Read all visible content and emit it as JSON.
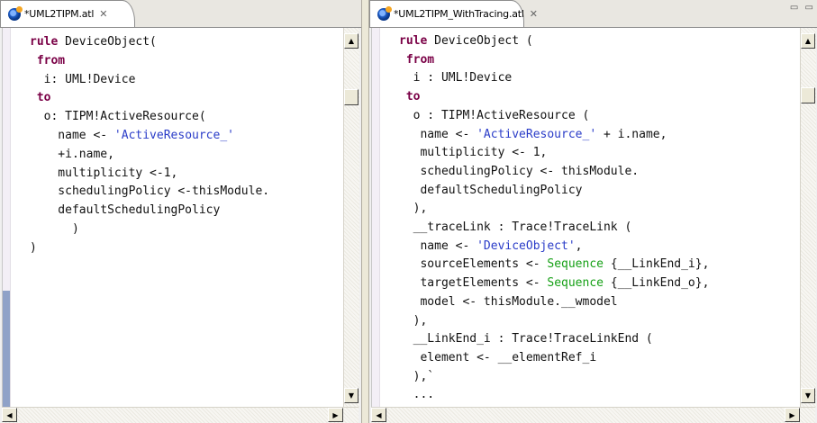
{
  "left_editor": {
    "tab_title": "*UML2TIPM.atl",
    "close_glyph": "✕",
    "lines": [
      [
        {
          "t": "rule",
          "c": "kw"
        },
        {
          "t": " DeviceObject("
        }
      ],
      [
        {
          "t": " "
        },
        {
          "t": "from",
          "c": "kw"
        }
      ],
      [
        {
          "t": "  i: UML!Device"
        }
      ],
      [
        {
          "t": " "
        },
        {
          "t": "to",
          "c": "kw"
        }
      ],
      [
        {
          "t": "  o: TIPM!ActiveResource("
        }
      ],
      [
        {
          "t": "    name <- "
        },
        {
          "t": "'ActiveResource_'",
          "c": "str"
        }
      ],
      [
        {
          "t": "    +i.name,"
        }
      ],
      [
        {
          "t": "    multiplicity <-1,"
        }
      ],
      [
        {
          "t": "    schedulingPolicy <-thisModule."
        }
      ],
      [
        {
          "t": "    defaultSchedulingPolicy"
        }
      ],
      [
        {
          "t": "      )"
        }
      ],
      [
        {
          "t": ")"
        }
      ]
    ]
  },
  "right_editor": {
    "tab_title": "*UML2TIPM_WithTracing.atl",
    "close_glyph": "✕",
    "view_controls": "▭ ▭",
    "lines": [
      [
        {
          "t": "rule",
          "c": "kw"
        },
        {
          "t": " DeviceObject ("
        }
      ],
      [
        {
          "t": " "
        },
        {
          "t": "from",
          "c": "kw"
        }
      ],
      [
        {
          "t": "  i : UML!Device"
        }
      ],
      [
        {
          "t": " "
        },
        {
          "t": "to",
          "c": "kw"
        }
      ],
      [
        {
          "t": "  o : TIPM!ActiveResource ("
        }
      ],
      [
        {
          "t": "   name <- "
        },
        {
          "t": "'ActiveResource_'",
          "c": "str"
        },
        {
          "t": " + i.name,"
        }
      ],
      [
        {
          "t": "   multiplicity <- 1,"
        }
      ],
      [
        {
          "t": "   schedulingPolicy <- thisModule."
        }
      ],
      [
        {
          "t": "   defaultSchedulingPolicy"
        }
      ],
      [
        {
          "t": "  ),"
        }
      ],
      [
        {
          "t": "  __traceLink : Trace!TraceLink ("
        }
      ],
      [
        {
          "t": "   name <- "
        },
        {
          "t": "'DeviceObject'",
          "c": "str"
        },
        {
          "t": ","
        }
      ],
      [
        {
          "t": "   sourceElements <- "
        },
        {
          "t": "Sequence",
          "c": "op"
        },
        {
          "t": " {__LinkEnd_i},"
        }
      ],
      [
        {
          "t": "   targetElements <- "
        },
        {
          "t": "Sequence",
          "c": "op"
        },
        {
          "t": " {__LinkEnd_o},"
        }
      ],
      [
        {
          "t": "   model <- thisModule.__wmodel"
        }
      ],
      [
        {
          "t": "  ),"
        }
      ],
      [
        {
          "t": "  __LinkEnd_i : Trace!TraceLinkEnd ("
        }
      ],
      [
        {
          "t": "   element <- __elementRef_i"
        }
      ],
      [
        {
          "t": "  ),`"
        }
      ],
      [
        {
          "t": "  ..."
        }
      ]
    ]
  },
  "scroll_glyphs": {
    "up": "▲",
    "down": "▼",
    "left": "◀",
    "right": "▶"
  },
  "colors": {
    "keyword": "#7a0046",
    "string": "#2a3cc8",
    "operation": "#16a016"
  }
}
